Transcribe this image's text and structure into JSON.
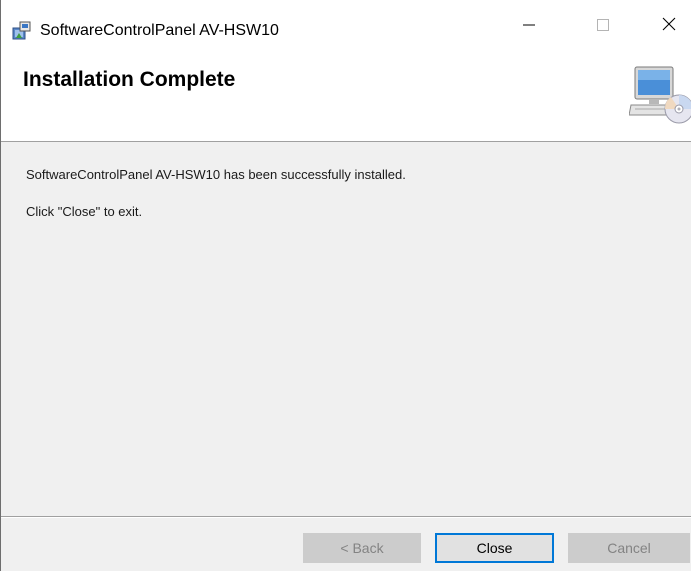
{
  "window": {
    "title": "SoftwareControlPanel AV-HSW10",
    "app_icon": "installer-package-icon",
    "controls": {
      "minimize": "minimize-icon",
      "maximize": "maximize-icon",
      "close": "close-icon"
    }
  },
  "banner": {
    "title": "Installation Complete",
    "icon": "computer-cd-icon"
  },
  "content": {
    "message": "SoftwareControlPanel AV-HSW10 has been successfully installed.",
    "instruction": "Click \"Close\" to exit."
  },
  "buttons": {
    "back": "< Back",
    "close": "Close",
    "cancel": "Cancel"
  },
  "colors": {
    "accent": "#0078d7",
    "window_bg": "#f0f0f0",
    "disabled_button": "#cccccc"
  }
}
